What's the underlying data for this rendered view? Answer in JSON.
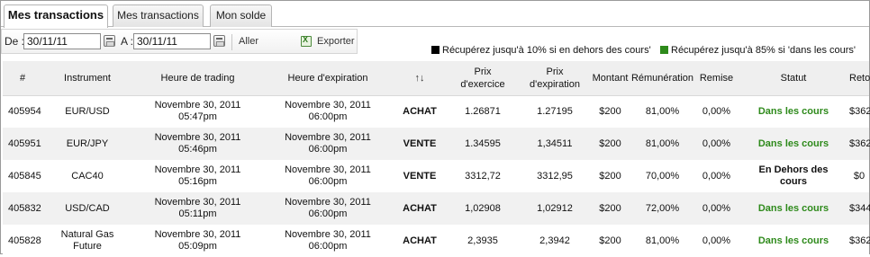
{
  "tabs": [
    {
      "label": "Mes transactions",
      "active": true
    },
    {
      "label": "Mes transactions",
      "active": false
    },
    {
      "label": "Mon solde",
      "active": false
    }
  ],
  "toolbar": {
    "from_label": "De :",
    "from_value": "30/11/11",
    "to_label": "A :",
    "to_value": "30/11/11",
    "go_label": "Aller",
    "export_label": "Exporter"
  },
  "legend": {
    "out_text": "Récupérez jusqu'à 10% si en dehors des cours'",
    "out_color": "#000000",
    "in_text": "Récupérez jusqu'à 85% si 'dans les cours'",
    "in_color": "#2e8a1b"
  },
  "columns": {
    "id": "#",
    "instrument": "Instrument",
    "trade_time": "Heure de trading",
    "expiry_time": "Heure d'expiration",
    "sort_icon": "↑↓",
    "strike_line1": "Prix",
    "strike_line2": "d'exercice",
    "expiry_price_line1": "Prix",
    "expiry_price_line2": "d'expiration",
    "amount": "Montant",
    "payout": "Rémunération",
    "refund": "Remise",
    "status": "Statut",
    "return": "Retour"
  },
  "rows": [
    {
      "id": "405954",
      "instrument": "EUR/USD",
      "instrument2": "",
      "trade_date": "Novembre 30, 2011",
      "trade_time": "05:47pm",
      "exp_date": "Novembre 30, 2011",
      "exp_time": "06:00pm",
      "direction": "ACHAT",
      "strike": "1.26871",
      "exp_price": "1.27195",
      "amount": "$200",
      "payout": "81,00%",
      "refund": "0,00%",
      "status": "Dans les cours",
      "status2": "",
      "in_money": true,
      "return": "$362"
    },
    {
      "id": "405951",
      "instrument": "EUR/JPY",
      "instrument2": "",
      "trade_date": "Novembre 30, 2011",
      "trade_time": "05:46pm",
      "exp_date": "Novembre 30, 2011",
      "exp_time": "06:00pm",
      "direction": "VENTE",
      "strike": "1.34595",
      "exp_price": "1,34511",
      "amount": "$200",
      "payout": "81,00%",
      "refund": "0,00%",
      "status": "Dans les cours",
      "status2": "",
      "in_money": true,
      "return": "$362"
    },
    {
      "id": "405845",
      "instrument": "CAC40",
      "instrument2": "",
      "trade_date": "Novembre 30, 2011",
      "trade_time": "05:16pm",
      "exp_date": "Novembre 30, 2011",
      "exp_time": "06:00pm",
      "direction": "VENTE",
      "strike": "3312,72",
      "exp_price": "3312,95",
      "amount": "$200",
      "payout": "70,00%",
      "refund": "0,00%",
      "status": "En Dehors des",
      "status2": "cours",
      "in_money": false,
      "return": "$0"
    },
    {
      "id": "405832",
      "instrument": "USD/CAD",
      "instrument2": "",
      "trade_date": "Novembre 30, 2011",
      "trade_time": "05:11pm",
      "exp_date": "Novembre 30, 2011",
      "exp_time": "06:00pm",
      "direction": "ACHAT",
      "strike": "1,02908",
      "exp_price": "1,02912",
      "amount": "$200",
      "payout": "72,00%",
      "refund": "0,00%",
      "status": "Dans les cours",
      "status2": "",
      "in_money": true,
      "return": "$344"
    },
    {
      "id": "405828",
      "instrument": "Natural Gas",
      "instrument2": "Future",
      "trade_date": "Novembre 30, 2011",
      "trade_time": "05:09pm",
      "exp_date": "Novembre 30, 2011",
      "exp_time": "06:00pm",
      "direction": "ACHAT",
      "strike": "2,3935",
      "exp_price": "2,3942",
      "amount": "$200",
      "payout": "81,00%",
      "refund": "0,00%",
      "status": "Dans les cours",
      "status2": "",
      "in_money": true,
      "return": "$362"
    }
  ]
}
